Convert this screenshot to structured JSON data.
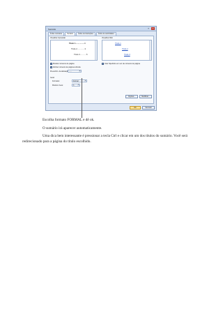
{
  "dialog": {
    "title": "Sumário",
    "help_icon": "question-icon",
    "close_icon": "close-icon",
    "tabs": [
      "Índice remissivo",
      "Sumário",
      "Índice de ilustrações",
      "Índice de autoridades"
    ],
    "print_preview_label": "Visualizar impressão",
    "print_preview_lines": [
      "Título 1..................1",
      "Título 2...............3",
      "Título 3.............5"
    ],
    "web_preview_label": "Visualizar Web",
    "web_preview_lines": [
      "Título 1",
      "Título 2",
      "Título 3"
    ],
    "show_page_numbers": "Mostrar números de página",
    "right_align_numbers": "Alinhar números de página à direita",
    "tab_leader_label": "Preenchim. da tabulação:",
    "tab_leader_value": "......",
    "hyperlinks_label": "Usar hiperlinks em vez de números de página",
    "general_label": "Geral",
    "formats_label": "Formatos:",
    "formats_value": "Formal",
    "levels_label": "Mostrar níveis:",
    "levels_value": "3",
    "options_button": "Opções...",
    "modify_button": "Modificar...",
    "ok_button": "OK",
    "cancel_button": "Cancelar"
  },
  "text": {
    "line1": "Escolha formato FORMAL e dê ok.",
    "line2": "O sumário irá aparecer automaticamente.",
    "line3": "Uma dica bem interessante é pressionar a tecla Ctrl e clicar em um dos títulos do sumário. Você será redirecionado para a página do título escolhido."
  }
}
